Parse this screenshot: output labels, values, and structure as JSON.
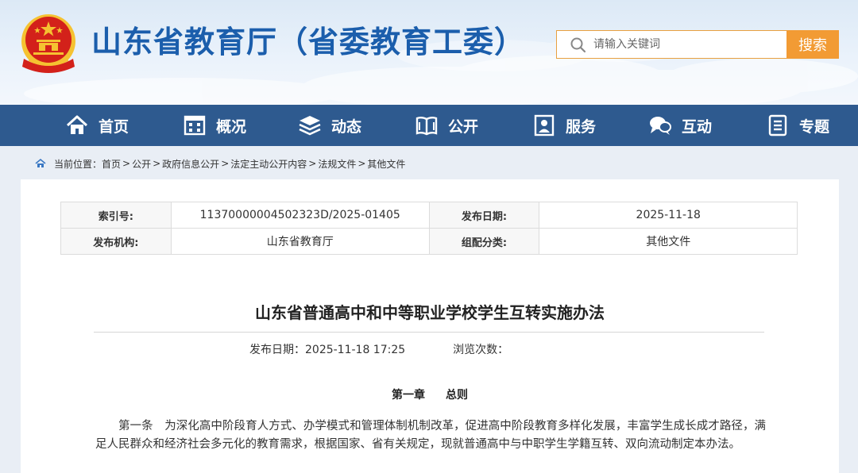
{
  "header": {
    "site_title": "山东省教育厅（省委教育工委）",
    "search_placeholder": "请输入关键词",
    "search_button": "搜索"
  },
  "nav": [
    {
      "label": "首页",
      "icon": "home-icon"
    },
    {
      "label": "概况",
      "icon": "building-icon"
    },
    {
      "label": "动态",
      "icon": "layers-icon"
    },
    {
      "label": "公开",
      "icon": "book-icon"
    },
    {
      "label": "服务",
      "icon": "service-icon"
    },
    {
      "label": "互动",
      "icon": "chat-icon"
    },
    {
      "label": "专题",
      "icon": "document-icon"
    }
  ],
  "breadcrumb": {
    "prefix": "当前位置：",
    "items": [
      "首页",
      "公开",
      "政府信息公开",
      "法定主动公开内容",
      "法规文件",
      "其他文件"
    ],
    "separator": ">"
  },
  "meta": {
    "index_label": "索引号:",
    "index_value": "11370000004502323D/2025-01405",
    "date_label": "发布日期:",
    "date_value": "2025-11-18",
    "org_label": "发布机构:",
    "org_value": "山东省教育厅",
    "category_label": "组配分类:",
    "category_value": "其他文件"
  },
  "article": {
    "title": "山东省普通高中和中等职业学校学生互转实施办法",
    "publish_label": "发布日期：",
    "publish_value": "2025-11-18 17:25",
    "views_label": "浏览次数：",
    "chapter_no": "第一章",
    "chapter_name": "总则",
    "paragraph": "第一条　为深化高中阶段育人方式、办学模式和管理体制机制改革，促进高中阶段教育多样化发展，丰富学生成长成才路径，满足人民群众和经济社会多元化的教育需求，根据国家、省有关规定，现就普通高中与中职学生学籍互转、双向流动制定本办法。"
  },
  "colors": {
    "title_blue": "#1b5eac",
    "nav_bg": "#2e5a8f",
    "search_orange": "#f29b34",
    "emblem_red": "#d3211a",
    "emblem_gold": "#f5c231"
  }
}
